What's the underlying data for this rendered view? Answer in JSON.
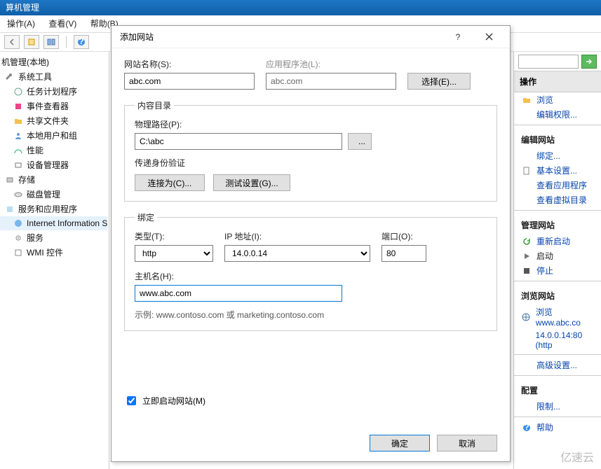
{
  "window_title": "算机管理",
  "menu": {
    "action": "操作(A)",
    "view": "查看(V)",
    "help": "帮助(B)"
  },
  "tree": {
    "root": "机管理(本地)",
    "sys_tools": "系统工具",
    "task_scheduler": "任务计划程序",
    "event_viewer": "事件查看器",
    "shared_folders": "共享文件夹",
    "local_users": "本地用户和组",
    "performance": "性能",
    "device_manager": "设备管理器",
    "storage": "存储",
    "disk_mgmt": "磁盘管理",
    "services_apps": "服务和应用程序",
    "iis": "Internet Information S",
    "services": "服务",
    "wmi": "WMI 控件"
  },
  "dialog": {
    "title": "添加网站",
    "site_name_lbl": "网站名称(S):",
    "app_pool_lbl": "应用程序池(L):",
    "site_name_val": "abc.com",
    "app_pool_val": "abc.com",
    "select_btn": "选择(E)...",
    "content_grp": "内容目录",
    "physical_path_lbl": "物理路径(P):",
    "physical_path_val": "C:\\abc",
    "browse_btn": "...",
    "passthru_lbl": "传递身份验证",
    "connect_as_btn": "连接为(C)...",
    "test_settings_btn": "测试设置(G)...",
    "binding_grp": "绑定",
    "type_lbl": "类型(T):",
    "type_val": "http",
    "ip_lbl": "IP 地址(I):",
    "ip_val": "14.0.0.14",
    "port_lbl": "端口(O):",
    "port_val": "80",
    "host_lbl": "主机名(H):",
    "host_val": "www.abc.com",
    "example_lbl": "示例: www.contoso.com 或 marketing.contoso.com",
    "start_now_lbl": "立即启动网站(M)",
    "ok_btn": "确定",
    "cancel_btn": "取消"
  },
  "actions": {
    "header": "操作",
    "browse": "浏览",
    "edit_perm": "编辑权限...",
    "edit_site": "编辑网站",
    "binding": "绑定...",
    "basic": "基本设置...",
    "view_apps": "查看应用程序",
    "view_vdir": "查看虚拟目录",
    "manage_site": "管理网站",
    "restart": "重新启动",
    "start": "启动",
    "stop": "停止",
    "browse_site": "浏览网站",
    "browse_link1": "浏览 www.abc.co",
    "browse_link2": "14.0.0.14:80 (http",
    "advanced": "高级设置...",
    "config": "配置",
    "limits": "限制...",
    "help": "帮助"
  },
  "watermark": "亿速云"
}
